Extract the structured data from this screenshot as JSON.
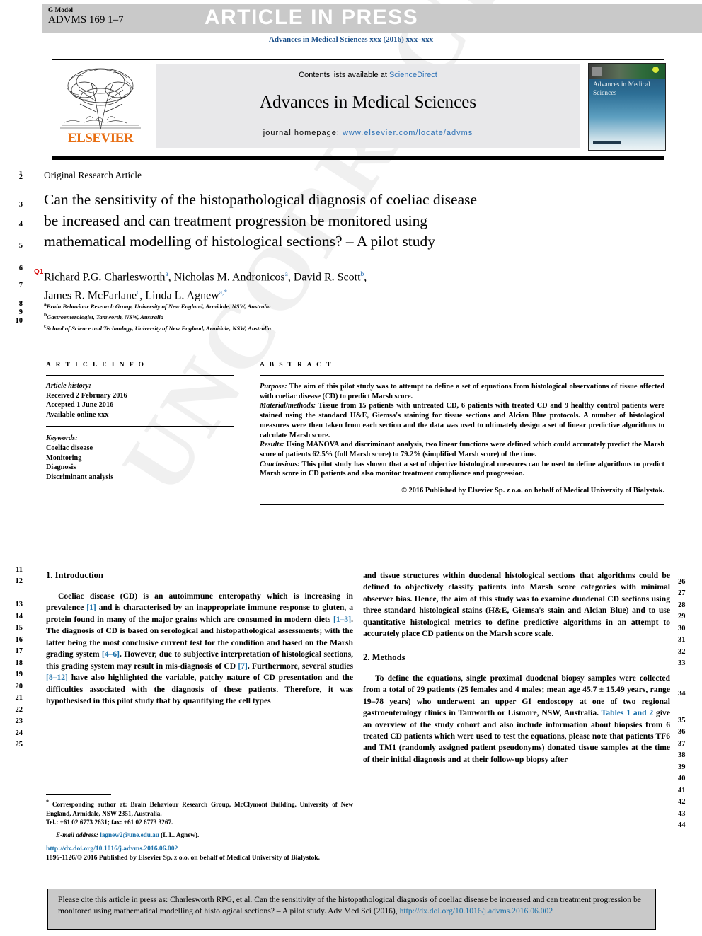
{
  "header": {
    "g_model_label": "G Model",
    "article_code": "ADVMS 169 1–7",
    "article_in_press": "ARTICLE IN PRESS",
    "journal_citation": "Advances in Medical Sciences xxx (2016) xxx–xxx"
  },
  "masthead": {
    "contents_prefix": "Contents lists available at ",
    "sciencedirect": "ScienceDirect",
    "journal_title": "Advances in Medical Sciences",
    "homepage_prefix": "journal homepage: ",
    "homepage_url": "www.elsevier.com/locate/advms",
    "publisher_logo_text": "ELSEVIER",
    "cover_text": "Advances in Medical Sciences"
  },
  "article": {
    "type_label": "Original Research Article",
    "query_marker": "Q1",
    "title_lines": [
      "Can the sensitivity of the histopathological diagnosis of coeliac disease",
      "be increased and can treatment progression be monitored using",
      "mathematical modelling of histological sections? – A pilot study"
    ],
    "authors_line1": "Richard P.G. Charlesworth",
    "authors": [
      {
        "name": "Richard P.G. Charlesworth",
        "sup": "a"
      },
      {
        "name": "Nicholas M. Andronicos",
        "sup": "a"
      },
      {
        "name": "David R. Scott",
        "sup": "b"
      },
      {
        "name": "James R. McFarlane",
        "sup": "c"
      },
      {
        "name": "Linda L. Agnew",
        "sup": "a,*"
      }
    ],
    "affiliations": [
      {
        "mark": "a",
        "text": "Brain Behaviour Research Group, University of New England, Armidale, NSW, Australia"
      },
      {
        "mark": "b",
        "text": "Gastroenterologist, Tamworth, NSW, Australia"
      },
      {
        "mark": "c",
        "text": "School of Science and Technology, University of New England, Armidale, NSW, Australia"
      }
    ]
  },
  "article_info": {
    "heading": "A R T I C L E   I N F O",
    "history_label": "Article history:",
    "history": [
      "Received 2 February 2016",
      "Accepted 1 June 2016",
      "Available online xxx"
    ],
    "keywords_label": "Keywords:",
    "keywords": [
      "Coeliac disease",
      "Monitoring",
      "Diagnosis",
      "Discriminant analysis"
    ]
  },
  "abstract": {
    "heading": "A B S T R A C T",
    "sections": [
      {
        "label": "Purpose:",
        "text": " The aim of this pilot study was to attempt to define a set of equations from histological observations of tissue affected with coeliac disease (CD) to predict Marsh score."
      },
      {
        "label": "Material/methods:",
        "text": " Tissue from 15 patients with untreated CD, 6 patients with treated CD and 9 healthy control patients were stained using the standard H&E, Giemsa's staining for tissue sections and Alcian Blue protocols. A number of histological measures were then taken from each section and the data was used to ultimately design a set of linear predictive algorithms to calculate Marsh score."
      },
      {
        "label": "Results:",
        "text": " Using MANOVA and discriminant analysis, two linear functions were defined which could accurately predict the Marsh score of patients 62.5% (full Marsh score) to 79.2% (simplified Marsh score) of the time."
      },
      {
        "label": "Conclusions:",
        "text": " This pilot study has shown that a set of objective histological measures can be used to define algorithms to predict Marsh score in CD patients and also monitor treatment compliance and progression."
      }
    ],
    "copyright": "© 2016 Published by Elsevier Sp. z o.o. on behalf of Medical University of Bialystok."
  },
  "body": {
    "intro_heading": "1. Introduction",
    "intro_p1_parts": [
      "Coeliac disease (CD) is an autoimmune enteropathy which is increasing in prevalence ",
      "[1]",
      " and is characterised by an inappropriate immune response to gluten, a protein found in many of the major grains which are consumed in modern diets ",
      "[1–3]",
      ". The diagnosis of CD is based on serological and histopathological assessments; with the latter being the most conclusive current test for the condition and based on the Marsh grading system ",
      "[4–6]",
      ". However, due to subjective interpretation of histological sections, this grading system may result in mis-diagnosis of CD ",
      "[7]",
      ". Furthermore, several studies ",
      "[8–12]",
      " have also highlighted the variable, patchy nature of CD presentation and the difficulties associated with the diagnosis of these patients. Therefore, it was hypothesised in this pilot study that by quantifying the cell types and tissue structures within duodenal histological sections that algorithms could be defined to objectively classify patients into Marsh score categories with minimal observer bias. Hence, the aim of this study was to examine duodenal CD sections using three standard histological stains (H&E, Giemsa's stain and Alcian Blue) and to use quantitative histological metrics to define predictive algorithms in an attempt to accurately place CD patients on the Marsh score scale."
    ],
    "intro_p1_left": "Coeliac disease (CD) is an autoimmune enteropathy which is increasing in prevalence [1] and is characterised by an inappropriate immune response to gluten, a protein found in many of the major grains which are consumed in modern diets [1–3]. The diagnosis of CD is based on serological and histopathological assessments; with the latter being the most conclusive current test for the condition and based on the Marsh grading system [4–6]. However, due to subjective interpretation of histological sections, this grading system may result in mis-diagnosis of CD [7]. Furthermore, several studies [8–12] have also highlighted the variable, patchy nature of CD presentation and the difficulties associated with the diagnosis of these patients. Therefore, it was hypothesised in this pilot study that by quantifying the cell types",
    "intro_p1_right": "and tissue structures within duodenal histological sections that algorithms could be defined to objectively classify patients into Marsh score categories with minimal observer bias. Hence, the aim of this study was to examine duodenal CD sections using three standard histological stains (H&E, Giemsa's stain and Alcian Blue) and to use quantitative histological metrics to define predictive algorithms in an attempt to accurately place CD patients on the Marsh score scale.",
    "methods_heading": "2. Methods",
    "methods_p1": "To define the equations, single proximal duodenal biopsy samples were collected from a total of 29 patients (25 females and 4 males; mean age 45.7 ± 15.49 years, range 19–78 years) who underwent an upper GI endoscopy at one of two regional gastroenterology clinics in Tamworth or Lismore, NSW, Australia. Tables 1 and 2 give an overview of the study cohort and also include information about biopsies from 6 treated CD patients which were used to test the equations, please note that patients TF6 and TM1 (randomly assigned patient pseudonyms) donated tissue samples at the time of their initial diagnosis and at their follow-up biopsy after",
    "methods_link": "Tables 1 and 2"
  },
  "footnote": {
    "corresponding": "Corresponding author at: Brain Behaviour Research Group, McClymont Building, University of New England, Armidale, NSW 2351, Australia.",
    "tel": "Tel.: +61 02 6773 2631; fax: +61 02 6773 3267.",
    "email_label": "E-mail address:",
    "email": "lagnew2@une.edu.au",
    "email_owner": "(L.L. Agnew).",
    "doi_url": "http://dx.doi.org/10.1016/j.advms.2016.06.002",
    "issn_line": "1896-1126/© 2016 Published by Elsevier Sp. z o.o. on behalf of Medical University of Bialystok."
  },
  "cite_box": {
    "text_before_link": "Please cite this article in press as: Charlesworth RPG, et al. Can the sensitivity of the histopathological diagnosis of coeliac disease be increased and can treatment progression be monitored using mathematical modelling of histological sections? – A pilot study. Adv Med Sci (2016), ",
    "link": "http://dx.doi.org/10.1016/j.advms.2016.06.002"
  },
  "watermark": "UNCORRECTED PROOF",
  "line_numbers": {
    "left": [
      "1",
      "2",
      "3",
      "4",
      "5",
      "6",
      "7",
      "8",
      "9",
      "10",
      "11",
      "12",
      "13",
      "14",
      "15",
      "16",
      "17",
      "18",
      "19",
      "20",
      "21",
      "22",
      "23",
      "24",
      "25"
    ],
    "right": [
      "26",
      "27",
      "28",
      "29",
      "30",
      "31",
      "32",
      "33",
      "34",
      "35",
      "36",
      "37",
      "38",
      "39",
      "40",
      "41",
      "42",
      "43",
      "44"
    ]
  },
  "colors": {
    "link": "#1a6fa8",
    "elsevier_orange": "#E86E12",
    "band_grey": "#c9c9c9",
    "query_red": "#d61111"
  }
}
